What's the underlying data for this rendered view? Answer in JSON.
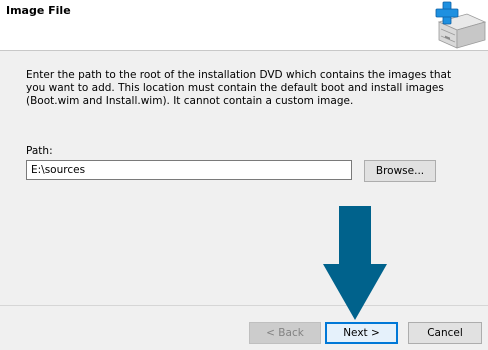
{
  "header": {
    "title": "Image File",
    "icon": "cabinet-plus-icon"
  },
  "main": {
    "description": "Enter the path to the root of the installation DVD which contains the images that you want to add. This location must contain the default boot and install images (Boot.wim and Install.wim). It cannot contain a custom image.",
    "path_label": "Path:",
    "path_value": "E:\\sources",
    "browse_label": "Browse..."
  },
  "footer": {
    "back_label": "< Back",
    "next_label": "Next >",
    "cancel_label": "Cancel"
  },
  "colors": {
    "arrow": "#00628c",
    "accent": "#0078d7"
  }
}
